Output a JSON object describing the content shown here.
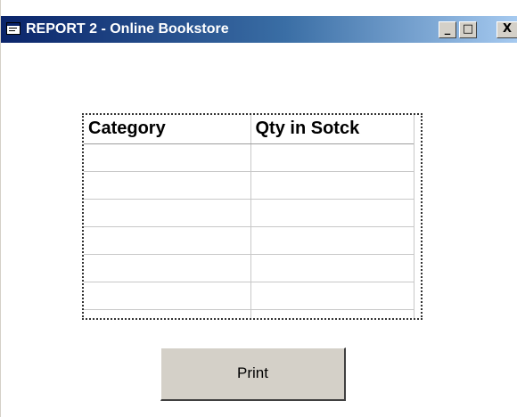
{
  "window": {
    "title": "REPORT 2 - Online Bookstore",
    "controls": {
      "minimize": "_",
      "maximize": "□",
      "close": "X"
    }
  },
  "grid": {
    "headers": [
      "Category",
      "Qty in Sotck"
    ],
    "rows": [
      [
        "",
        ""
      ],
      [
        "",
        ""
      ],
      [
        "",
        ""
      ],
      [
        "",
        ""
      ],
      [
        "",
        ""
      ],
      [
        "",
        ""
      ],
      [
        "",
        ""
      ]
    ]
  },
  "print_button": {
    "label": "Print"
  },
  "colors": {
    "titlebar_start": "#0a246a",
    "titlebar_end": "#a6caf0",
    "button_face": "#d4d0c8"
  }
}
